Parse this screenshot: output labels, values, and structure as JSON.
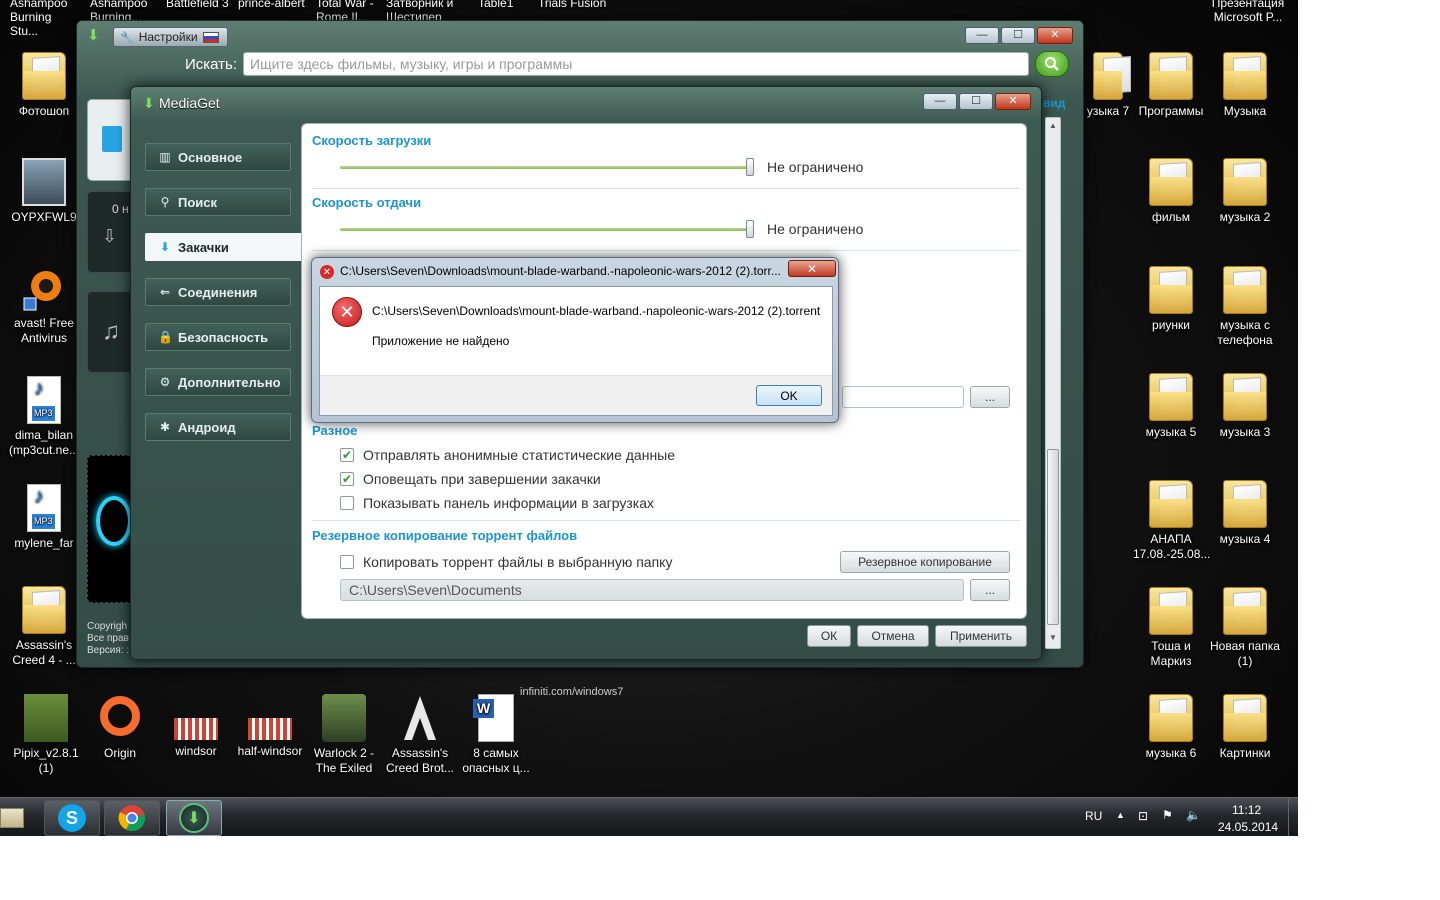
{
  "top_labels": [
    {
      "text": "Ashampoo Burning Stu..."
    },
    {
      "text": "Ashampoo Burning..."
    },
    {
      "text": "Battlefield 3"
    },
    {
      "text": "prince-albert"
    },
    {
      "text": "Total War - Rome II..."
    },
    {
      "text": "Затворник и Шестипер"
    },
    {
      "text": "Table1"
    },
    {
      "text": "Trials Fusion"
    },
    {
      "text": "Презентация Microsoft P..."
    }
  ],
  "desktop_left": [
    {
      "label": "Фотошоп",
      "icon": "folder-icon"
    },
    {
      "label": "OYPXFWL9",
      "icon": "image-icon"
    },
    {
      "label": "avast! Free Antivirus",
      "icon": "avast-icon"
    },
    {
      "label": "dima_bilan (mp3cut.ne...",
      "icon": "mp3-icon"
    },
    {
      "label": "mylene_far",
      "icon": "mp3-icon"
    },
    {
      "label": "Assassin's Creed 4 - ...",
      "icon": "folder-icon"
    }
  ],
  "desktop_bottom": [
    {
      "label": "Pipix_v2.8.1 (1)",
      "icon": "minecraft-icon"
    },
    {
      "label": "Origin",
      "icon": "origin-icon"
    },
    {
      "label": "windsor",
      "icon": "image-icon"
    },
    {
      "label": "half-windsor",
      "icon": "image-icon"
    },
    {
      "label": "Warlock 2 - The Exiled",
      "icon": "game-icon"
    },
    {
      "label": "Assassin's Creed Brot...",
      "icon": "game-icon"
    },
    {
      "label": "8 самых опасных ц...",
      "icon": "word-icon"
    }
  ],
  "desktop_right": [
    {
      "label": "узыка 7"
    },
    {
      "label": "Программы"
    },
    {
      "label": "Музыка"
    },
    {
      "label": "фильм"
    },
    {
      "label": "музыка 2"
    },
    {
      "label": "риунки"
    },
    {
      "label": "музыка с телефона"
    },
    {
      "label": "музыка 5"
    },
    {
      "label": "музыка  3"
    },
    {
      "label": "АНАПА 17.08.-25.08..."
    },
    {
      "label": "музыка 4"
    },
    {
      "label": "Тоша и Маркиз"
    },
    {
      "label": "Новая папка (1)"
    },
    {
      "label": "музыка 6"
    },
    {
      "label": "Картинки"
    }
  ],
  "watermark": "infiniti.com/windows7",
  "settings_window": {
    "tab_title": "Настройки",
    "search_label": "Искать:",
    "search_placeholder": "Ищите здесь фильмы, музыку, игры и программы",
    "side_text": "0 н",
    "copyright_lines": [
      "Copyrigh",
      "Все прав",
      "Версия: :"
    ],
    "right_link": "вид"
  },
  "mediaget": {
    "title": "MediaGet",
    "nav": [
      {
        "label": "Основное",
        "icon": "grid-icon",
        "active": false
      },
      {
        "label": "Поиск",
        "icon": "search-icon",
        "active": false
      },
      {
        "label": "Закачки",
        "icon": "download-icon",
        "active": true
      },
      {
        "label": "Соединения",
        "icon": "connection-icon",
        "active": false
      },
      {
        "label": "Безопасность",
        "icon": "lock-icon",
        "active": false
      },
      {
        "label": "Дополнительно",
        "icon": "gear-icon",
        "active": false
      },
      {
        "label": "Андроид",
        "icon": "android-icon",
        "active": false
      }
    ],
    "download_speed": {
      "heading": "Скорость загрузки",
      "value": "Не ограничено"
    },
    "upload_speed": {
      "heading": "Скорость отдачи",
      "value": "Не ограничено"
    },
    "misc": {
      "heading": "Разное",
      "options": [
        {
          "label": "Отправлять анонимные статистические данные",
          "checked": true
        },
        {
          "label": "Оповещать при завершении закачки",
          "checked": true
        },
        {
          "label": "Показывать панель информации в загрузках",
          "checked": false
        }
      ]
    },
    "backup": {
      "heading": "Резервное копирование торрент файлов",
      "option_label": "Копировать торрент файлы в выбранную папку",
      "option_checked": false,
      "button": "Резервное копирование",
      "path": "C:\\Users\\Seven\\Documents",
      "browse": "..."
    },
    "upper_browse": "...",
    "buttons": {
      "ok": "ОК",
      "cancel": "Отмена",
      "apply": "Применить"
    }
  },
  "error_dialog": {
    "title": "C:\\Users\\Seven\\Downloads\\mount-blade-warband.-napoleonic-wars-2012 (2).torr...",
    "path": "C:\\Users\\Seven\\Downloads\\mount-blade-warband.-napoleonic-wars-2012 (2).torrent",
    "message": "Приложение не найдено",
    "ok": "OK"
  },
  "taskbar": {
    "language": "RU",
    "time": "11:12",
    "date": "24.05.2014",
    "apps": [
      "skype-icon",
      "chrome-icon",
      "mediaget-icon"
    ]
  }
}
